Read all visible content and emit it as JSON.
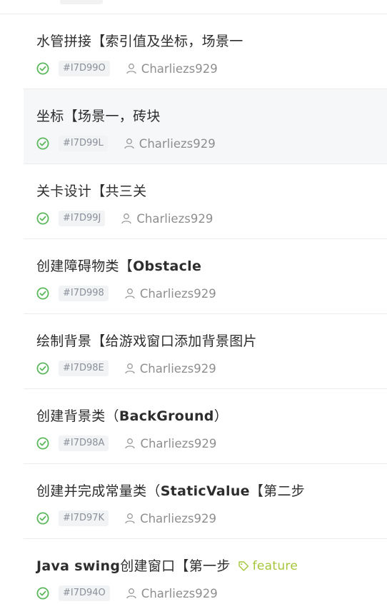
{
  "colors": {
    "status_closed": "#5cb85c",
    "tag_feature": "#a5c63b",
    "row_hover": "#f6f7f9"
  },
  "issues": [
    {
      "title": "水管拼接【索引值及坐标，场景一",
      "id": "#I7D99O",
      "author": "Charliezs929",
      "status_icon": "check-circle-icon"
    },
    {
      "title": "坐标【场景一，砖块",
      "id": "#I7D99L",
      "author": "Charliezs929",
      "status_icon": "check-circle-icon"
    },
    {
      "title": "关卡设计【共三关",
      "id": "#I7D99J",
      "author": "Charliezs929",
      "status_icon": "check-circle-icon"
    },
    {
      "title_cn": "创建障碍物类【",
      "title_latin": "Obstacle",
      "id": "#I7D998",
      "author": "Charliezs929",
      "status_icon": "check-circle-icon"
    },
    {
      "title": "绘制背景【给游戏窗口添加背景图片",
      "id": "#I7D98E",
      "author": "Charliezs929",
      "status_icon": "check-circle-icon"
    },
    {
      "title_cn": "创建背景类（",
      "title_latin": "BackGround",
      "title_end": "）",
      "id": "#I7D98A",
      "author": "Charliezs929",
      "status_icon": "check-circle-icon"
    },
    {
      "title_cn": "创建并完成常量类（",
      "title_latin": "StaticValue",
      "title_end": "【第二步",
      "id": "#I7D97K",
      "author": "Charliezs929",
      "status_icon": "check-circle-icon"
    },
    {
      "title_latin": "Java swing",
      "title_cn": "创建窗口【第一步",
      "tag": "feature",
      "id": "#I7D94O",
      "author": "Charliezs929",
      "status_icon": "check-circle-icon"
    }
  ]
}
